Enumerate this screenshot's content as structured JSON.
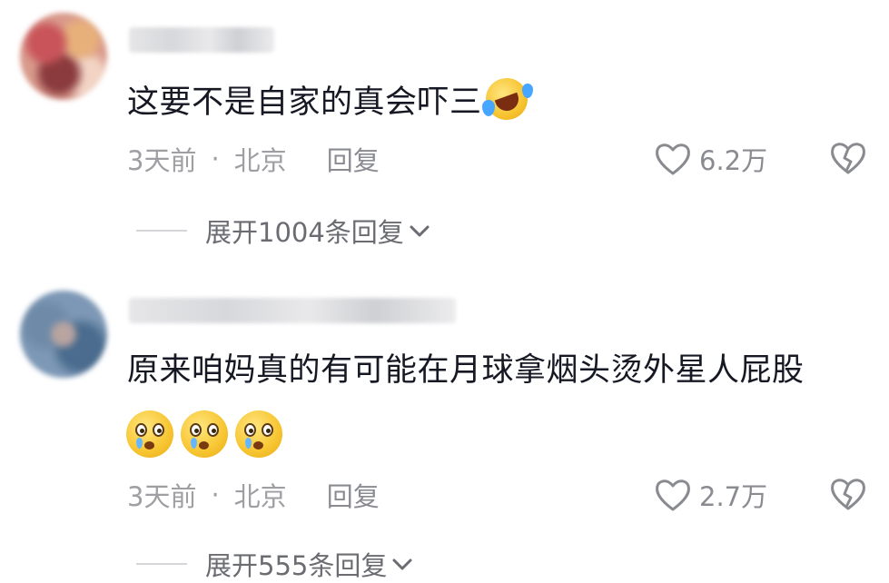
{
  "comments": [
    {
      "text": "这要不是自家的真会吓三",
      "time": "3天前",
      "separator": "·",
      "location": "北京",
      "reply_label": "回复",
      "likes": "6.2万",
      "expand_label": "展开1004条回复"
    },
    {
      "text": "原来咱妈真的有可能在月球拿烟头烫外星人屁股",
      "time": "3天前",
      "separator": "·",
      "location": "北京",
      "reply_label": "回复",
      "likes": "2.7万",
      "expand_label": "展开555条回复"
    }
  ],
  "icons": {
    "like": "heart-outline-icon",
    "dislike": "broken-heart-icon",
    "expand": "chevron-down-icon"
  },
  "colors": {
    "text_primary": "#161823",
    "text_secondary": "#9e9ea3",
    "text_action": "#8a8b91"
  }
}
